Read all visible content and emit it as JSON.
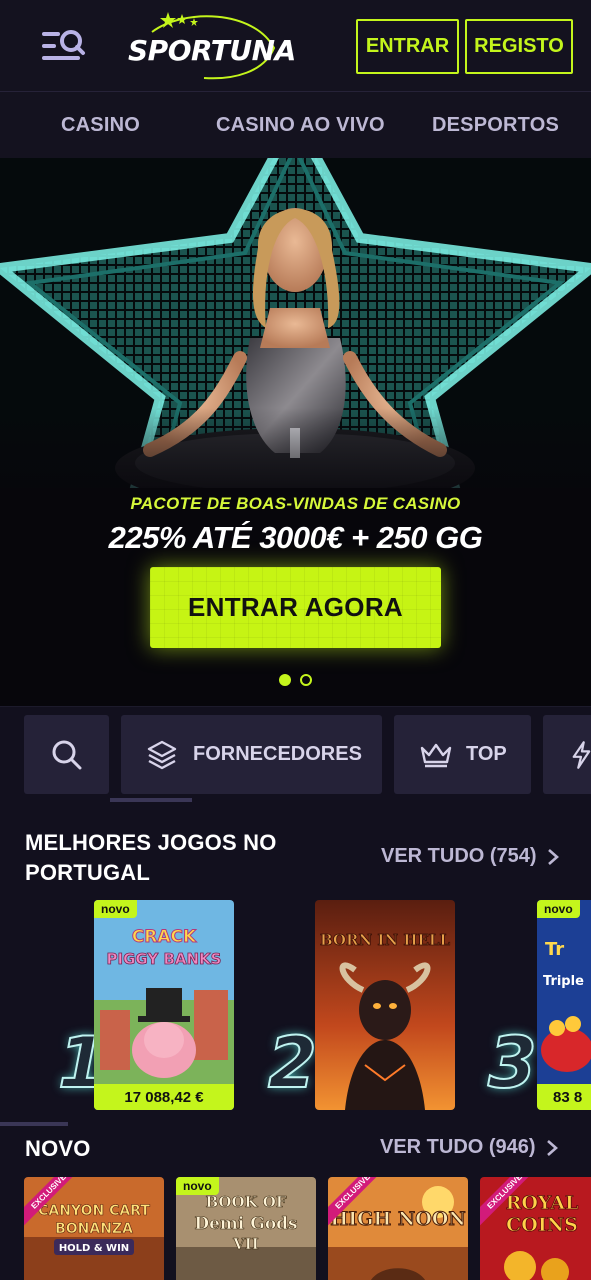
{
  "header": {
    "brand": "SPORTUNA",
    "login_label": "ENTRAR",
    "register_label": "REGISTO",
    "accent_color": "#c4f51c"
  },
  "nav": {
    "tabs": [
      {
        "label": "CASINO"
      },
      {
        "label": "CASINO AO VIVO"
      },
      {
        "label": "DESPORTOS"
      }
    ]
  },
  "hero": {
    "promo_subtitle": "PACOTE DE BOAS-VINDAS DE CASINO",
    "promo_title": "225% ATÉ 3000€ + 250 GG",
    "cta_label": "ENTRAR AGORA",
    "slides_total": 2,
    "active_slide": 1
  },
  "filters": {
    "search_icon": "search-icon",
    "items": [
      {
        "label": "FORNECEDORES",
        "icon": "layers-icon"
      },
      {
        "label": "TOP",
        "icon": "crown-icon"
      },
      {
        "label": "",
        "icon": "lightning-icon"
      }
    ]
  },
  "top_games": {
    "title_line1": "MELHORES JOGOS NO",
    "title_line2": "PORTUGAL",
    "view_all": "VER TUDO (754)",
    "cards": [
      {
        "rank": "1",
        "name": "CRACK MORE PIGGY BANKS",
        "badge": "novo",
        "price": "17 088,42 €"
      },
      {
        "rank": "2",
        "name": "BORN IN HELL",
        "badge": "",
        "price": ""
      },
      {
        "rank": "3",
        "name": "TRIPLE",
        "badge": "novo",
        "price": "83 8"
      }
    ]
  },
  "new_games": {
    "title": "NOVO",
    "view_all": "VER TUDO (946)",
    "cards": [
      {
        "name": "CANYON CART BONANZA",
        "sub": "HOLD & WIN",
        "badge": "EXCLUSIVE"
      },
      {
        "name": "BOOK OF DEMI GODS VII",
        "badge": "novo"
      },
      {
        "name": "HIGH NOON",
        "badge": "EXCLUSIVE"
      },
      {
        "name": "ROYAL COINS",
        "badge": "EXCLUSIVE"
      }
    ]
  }
}
